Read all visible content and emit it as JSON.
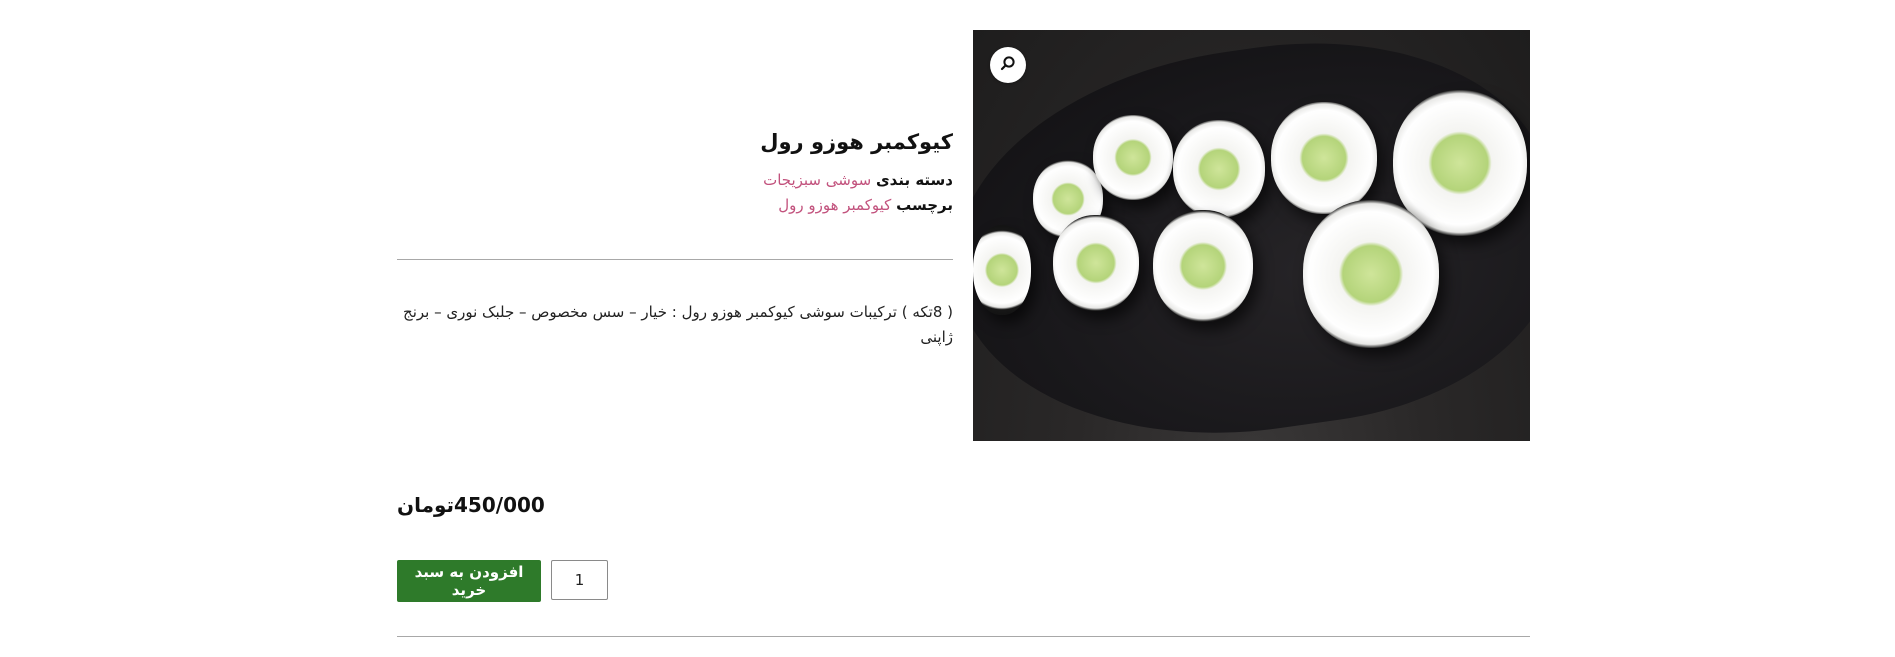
{
  "product": {
    "title": "کیوکمبر هوزو رول",
    "category_label": "دسته بندی",
    "category_value": "سوشی سبزیجات",
    "tag_label": "برچسب",
    "tag_value": "کیوکمبر هوزو رول",
    "description": "( 8تکه ) ترکیبات سوشی کیوکمبر هوزو رول : خیار – سس مخصوص – جلبک نوری – برنج ژاپنی",
    "price": "450/000تومان",
    "quantity": "1",
    "add_to_cart_label": "افزودن به سبد خرید"
  },
  "icons": {
    "zoom": "search-zoom-icon"
  },
  "colors": {
    "link": "#c2527d",
    "button": "#2e7a2a",
    "divider": "#a8a8a8"
  }
}
